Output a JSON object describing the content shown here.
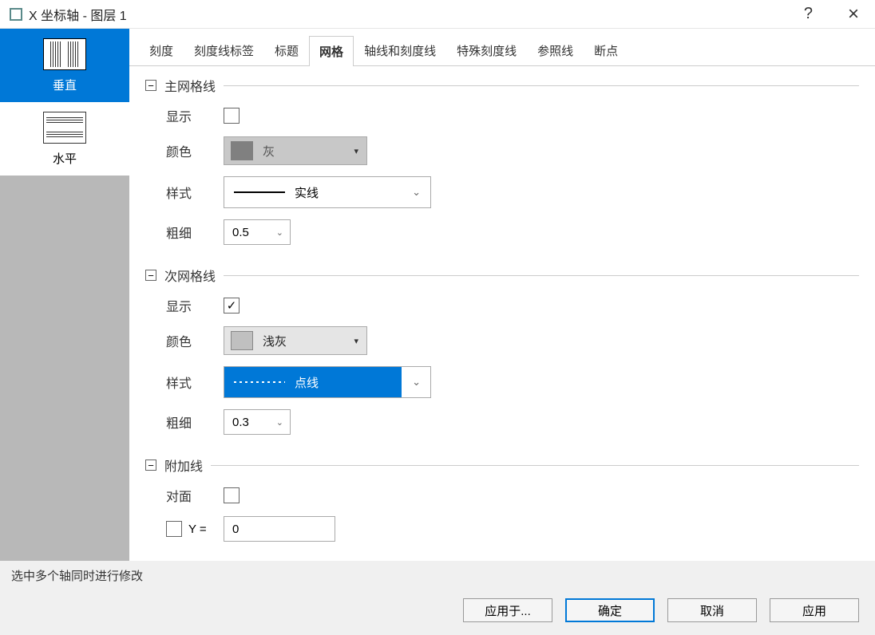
{
  "titlebar": {
    "title": "X 坐标轴 - 图层 1",
    "help": "?",
    "close": "×"
  },
  "sidebar": {
    "items": [
      {
        "label": "垂直",
        "selected": true
      },
      {
        "label": "水平",
        "selected": false
      }
    ]
  },
  "tabs": [
    {
      "label": "刻度"
    },
    {
      "label": "刻度线标签"
    },
    {
      "label": "标题"
    },
    {
      "label": "网格",
      "active": true
    },
    {
      "label": "轴线和刻度线"
    },
    {
      "label": "特殊刻度线"
    },
    {
      "label": "参照线"
    },
    {
      "label": "断点"
    }
  ],
  "sections": {
    "major": {
      "title": "主网格线",
      "show_label": "显示",
      "show_checked": false,
      "color_label": "颜色",
      "color_value": "灰",
      "style_label": "样式",
      "style_value": "实线",
      "width_label": "粗细",
      "width_value": "0.5"
    },
    "minor": {
      "title": "次网格线",
      "show_label": "显示",
      "show_checked": true,
      "color_label": "颜色",
      "color_value": "浅灰",
      "style_label": "样式",
      "style_value": "点线",
      "width_label": "粗细",
      "width_value": "0.3"
    },
    "additional": {
      "title": "附加线",
      "opposite_label": "对面",
      "opposite_checked": false,
      "y_label": "Y =",
      "y_checked": false,
      "y_value": "0"
    }
  },
  "hint": "选中多个轴同时进行修改",
  "buttons": {
    "apply_to": "应用于...",
    "ok": "确定",
    "cancel": "取消",
    "apply": "应用"
  }
}
